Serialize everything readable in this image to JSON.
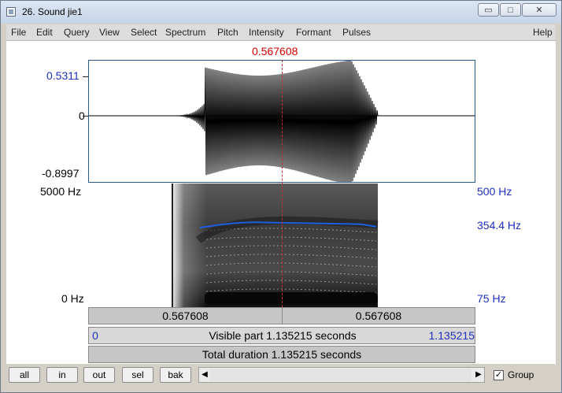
{
  "window": {
    "title": "26. Sound jie1",
    "minimize": "▭",
    "maximize": "□",
    "close": "✕"
  },
  "menu": [
    "File",
    "Edit",
    "Query",
    "View",
    "Select",
    "Spectrum",
    "Pitch",
    "Intensity",
    "Formant",
    "Pulses",
    "Help"
  ],
  "cursor_time": "0.567608",
  "waveform": {
    "y_max_label": "0.5311",
    "y_zero_label": "0",
    "y_min_label": "-0.8997"
  },
  "spectrogram": {
    "freq_top_label": "5000 Hz",
    "freq_bottom_label": "0 Hz",
    "pitch_top_label": "500 Hz",
    "pitch_current_label": "354.4 Hz",
    "pitch_bottom_label": "75 Hz",
    "pitch_color": "#1e5fe0"
  },
  "time_bar": {
    "left_segment": "0.567608",
    "right_segment": "0.567608",
    "visible_start": "0",
    "visible_label": "Visible part 1.135215 seconds",
    "visible_end": "1.135215",
    "total_label": "Total duration 1.135215 seconds"
  },
  "nav_buttons": [
    "all",
    "in",
    "out",
    "sel",
    "bak"
  ],
  "scroll": {
    "left_arrow": "◀",
    "right_arrow": "▶"
  },
  "group": {
    "label": "Group",
    "checked": true,
    "mark": "✓"
  },
  "colors": {
    "cursor": "#d40000",
    "axis_blue": "#1f2fbf"
  }
}
